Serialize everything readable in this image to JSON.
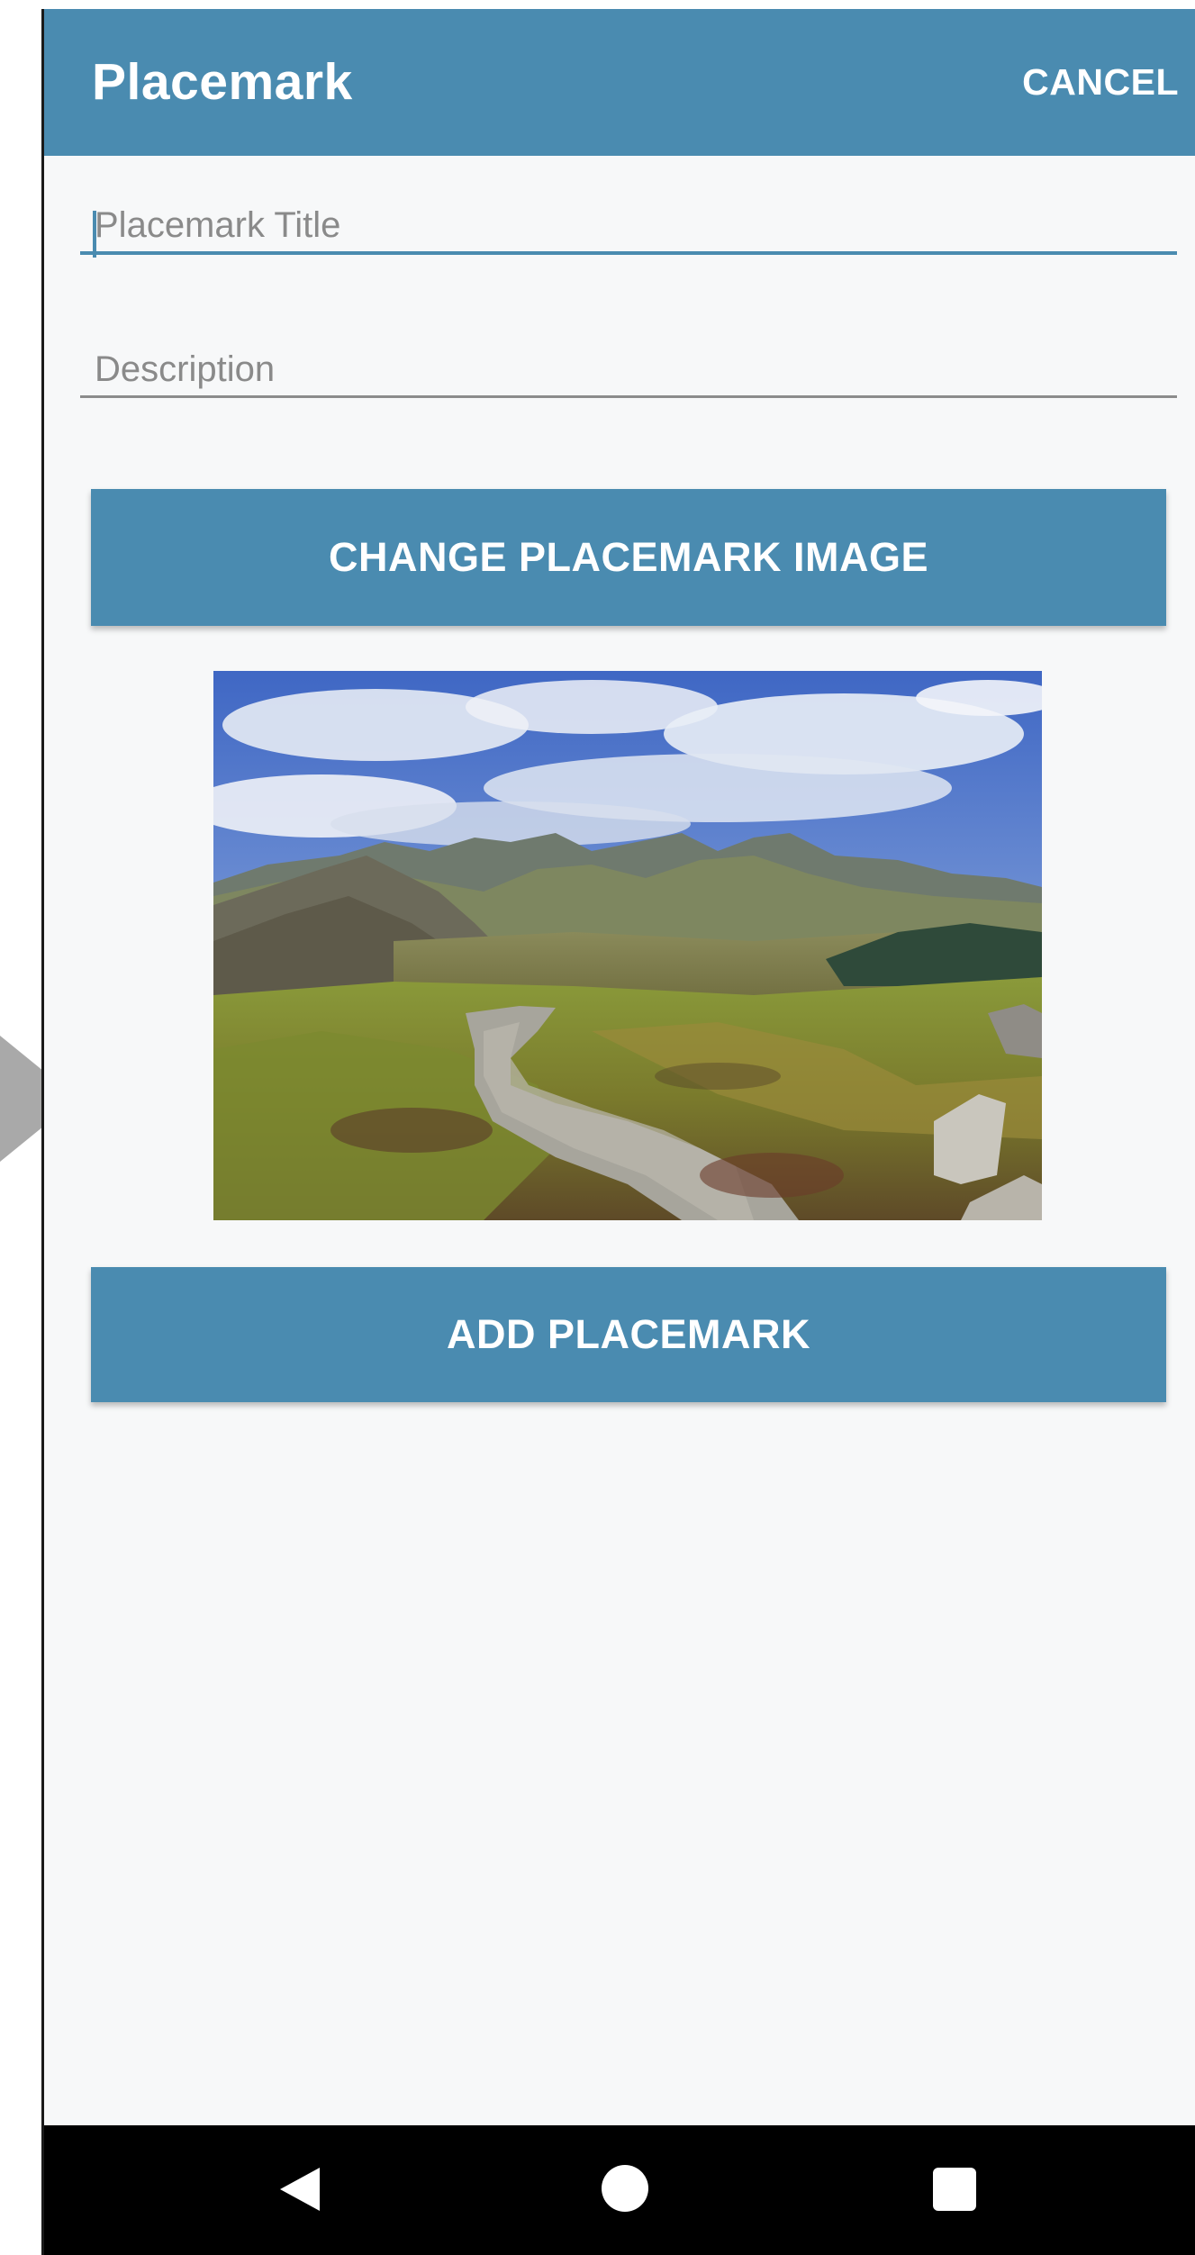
{
  "app_bar": {
    "title": "Placemark",
    "action_label": "CANCEL",
    "color": "#4a8bb0"
  },
  "form": {
    "title_placeholder": "Placemark Title",
    "title_value": "",
    "description_placeholder": "Description",
    "description_value": ""
  },
  "buttons": {
    "change_image_label": "CHANGE PLACEMARK IMAGE",
    "add_label": "ADD PLACEMARK"
  },
  "image": {
    "subject": "mountain landscape with gravel path"
  },
  "nav_bar": {
    "back_icon": "back-icon",
    "home_icon": "home-icon",
    "recents_icon": "recents-icon"
  }
}
